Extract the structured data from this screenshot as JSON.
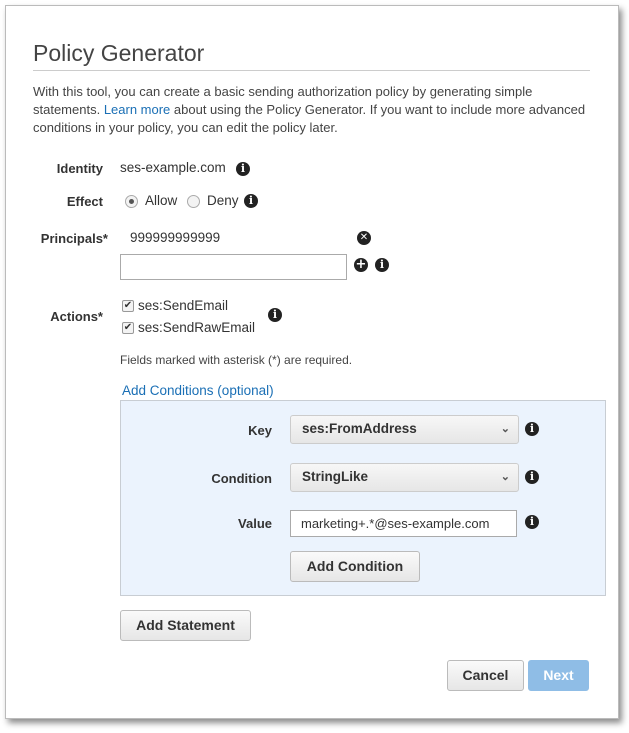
{
  "title": "Policy Generator",
  "intro": {
    "before": "With this tool, you can create a basic sending authorization policy by generating simple statements. ",
    "link": "Learn more",
    "after": " about using the Policy Generator. If you want to include more advanced conditions in your policy, you can edit the policy later."
  },
  "identity": {
    "label": "Identity",
    "value": "ses-example.com"
  },
  "effect": {
    "label": "Effect",
    "options": [
      "Allow",
      "Deny"
    ],
    "selected": "Allow"
  },
  "principals": {
    "label": "Principals*",
    "values": [
      "999999999999"
    ],
    "input_value": ""
  },
  "actions": {
    "label": "Actions*",
    "items": [
      {
        "label": "ses:SendEmail",
        "checked": true
      },
      {
        "label": "ses:SendRawEmail",
        "checked": true
      }
    ]
  },
  "required_note": "Fields marked with asterisk (*) are required.",
  "conditions": {
    "link": "Add Conditions (optional)",
    "key_label": "Key",
    "key_value": "ses:FromAddress",
    "condition_label": "Condition",
    "condition_value": "StringLike",
    "value_label": "Value",
    "value": "marketing+.*@ses-example.com",
    "add_condition": "Add Condition"
  },
  "buttons": {
    "add_statement": "Add Statement",
    "cancel": "Cancel",
    "next": "Next"
  },
  "colors": {
    "accent": "#1a6fb5",
    "panel": "#ebf3fd",
    "next": "#8fbde6"
  }
}
